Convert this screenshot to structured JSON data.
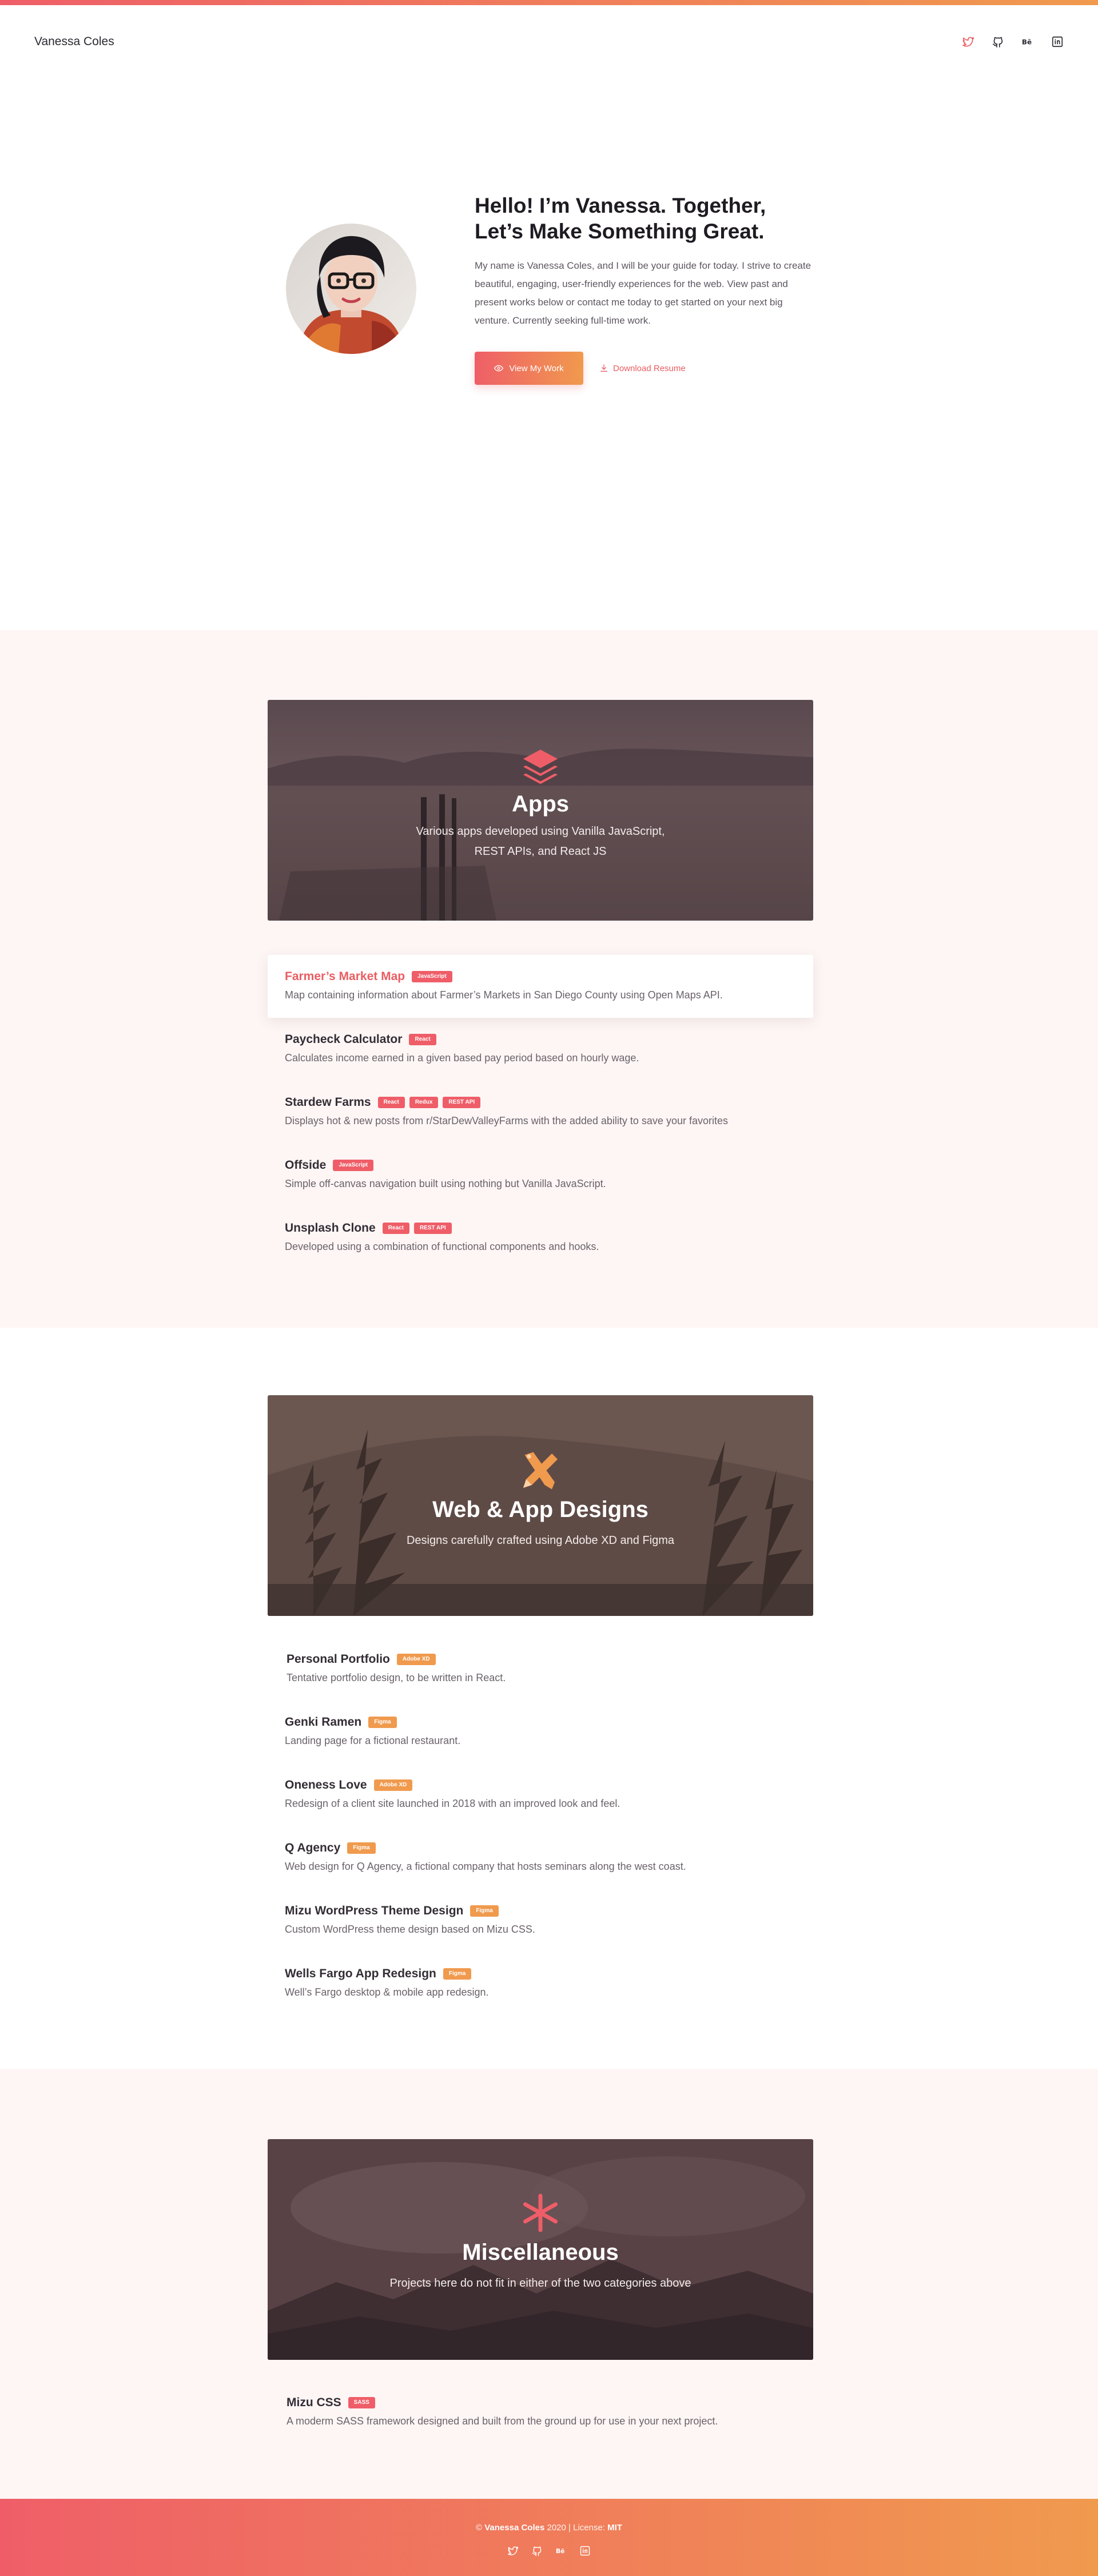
{
  "header": {
    "brand": "Vanessa Coles",
    "icons": [
      "twitter-icon",
      "github-icon",
      "behance-icon",
      "linkedin-icon"
    ]
  },
  "hero": {
    "title": "Hello!  I’m Vanessa.  Together, Let’s Make Something Great.",
    "description": "My name is Vanessa Coles, and I will be your guide for today.  I strive to create beautiful, engaging, user-friendly experiences for the web.  View past and present works below or contact me today to get started on your next big venture.  Currently seeking full-time work.",
    "primary_button": "View My Work",
    "secondary_button": "Download Resume"
  },
  "apps": {
    "title": "Apps",
    "subtitle_line1": "Various apps developed using Vanilla JavaScript,",
    "subtitle_line2": "REST APIs, and React JS",
    "projects": [
      {
        "title": "Farmer’s Market Map",
        "tags": [
          "JavaScript"
        ],
        "desc": "Map containing information about Farmer’s Markets in San Diego County using Open Maps API."
      },
      {
        "title": "Paycheck Calculator",
        "tags": [
          "React"
        ],
        "desc": "Calculates income earned in a given based pay period based on hourly wage."
      },
      {
        "title": "Stardew Farms",
        "tags": [
          "React",
          "Redux",
          "REST API"
        ],
        "desc": "Displays hot & new posts from r/StarDewValleyFarms with the added ability to save your favorites"
      },
      {
        "title": "Offside",
        "tags": [
          "JavaScript"
        ],
        "desc": "Simple off-canvas navigation built using nothing but Vanilla JavaScript."
      },
      {
        "title": "Unsplash Clone",
        "tags": [
          "React",
          "REST API"
        ],
        "desc": "Developed using a combination of functional components and hooks."
      }
    ]
  },
  "designs": {
    "title": "Web & App Designs",
    "subtitle": "Designs carefully crafted using Adobe XD and Figma",
    "projects": [
      {
        "title": "Personal Portfolio",
        "tags": [
          "Adobe XD"
        ],
        "desc": "Tentative portfolio design, to be written in React."
      },
      {
        "title": "Genki Ramen",
        "tags": [
          "Figma"
        ],
        "desc": "Landing page for a fictional restaurant."
      },
      {
        "title": "Oneness Love",
        "tags": [
          "Adobe XD"
        ],
        "desc": "Redesign of a client site launched in 2018 with an improved look and feel."
      },
      {
        "title": "Q Agency",
        "tags": [
          "Figma"
        ],
        "desc": "Web design for Q Agency, a fictional company that hosts seminars along the west coast."
      },
      {
        "title": "Mizu WordPress Theme Design",
        "tags": [
          "Figma"
        ],
        "desc": "Custom WordPress theme design based on Mizu CSS."
      },
      {
        "title": "Wells Fargo App Redesign",
        "tags": [
          "Figma"
        ],
        "desc": "Well’s Fargo desktop & mobile app redesign."
      }
    ]
  },
  "misc": {
    "title": "Miscellaneous",
    "subtitle": "Projects here do not fit in either of the two categories above",
    "projects": [
      {
        "title": "Mizu CSS",
        "tags": [
          "SASS"
        ],
        "desc": "A moderm SASS framework designed and built from the ground up for use in your next project."
      }
    ]
  },
  "footer": {
    "copyright": "©",
    "name": "Vanessa Coles",
    "year": "2020",
    "separator": "|",
    "license_label": "License:",
    "license": "MIT"
  },
  "colors": {
    "accent_red": "#ef5e68",
    "accent_orange": "#f09a4e",
    "tint_bg": "#fdf6f5"
  }
}
